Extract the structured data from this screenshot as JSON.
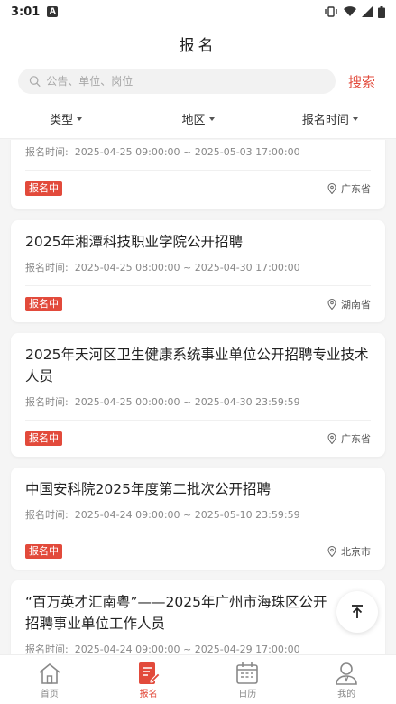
{
  "status_bar": {
    "time": "3:01",
    "notification_badge": "A"
  },
  "header": {
    "title": "报名"
  },
  "search": {
    "placeholder": "公告、单位、岗位",
    "button_label": "搜索"
  },
  "filters": [
    {
      "label": "类型"
    },
    {
      "label": "地区"
    },
    {
      "label": "报名时间"
    }
  ],
  "colors": {
    "accent": "#e24a3b"
  },
  "cards": [
    {
      "title": "",
      "time_label": "报名时间:",
      "time_range": "2025-04-25 09:00:00 ~ 2025-05-03 17:00:00",
      "status": "报名中",
      "location": "广东省"
    },
    {
      "title": "2025年湘潭科技职业学院公开招聘",
      "time_label": "报名时间:",
      "time_range": "2025-04-25 08:00:00 ~ 2025-04-30 17:00:00",
      "status": "报名中",
      "location": "湖南省"
    },
    {
      "title": "2025年天河区卫生健康系统事业单位公开招聘专业技术人员",
      "time_label": "报名时间:",
      "time_range": "2025-04-25 00:00:00 ~ 2025-04-30 23:59:59",
      "status": "报名中",
      "location": "广东省"
    },
    {
      "title": "中国安科院2025年度第二批次公开招聘",
      "time_label": "报名时间:",
      "time_range": "2025-04-24 09:00:00 ~ 2025-05-10 23:59:59",
      "status": "报名中",
      "location": "北京市"
    },
    {
      "title": "“百万英才汇南粤”——2025年广州市海珠区公开招聘事业单位工作人员",
      "time_label": "报名时间:",
      "time_range": "2025-04-24 09:00:00 ~ 2025-04-29 17:00:00",
      "status": "",
      "location": ""
    }
  ],
  "tabs": [
    {
      "label": "首页",
      "icon": "home-icon"
    },
    {
      "label": "报名",
      "icon": "signup-icon"
    },
    {
      "label": "日历",
      "icon": "calendar-icon"
    },
    {
      "label": "我的",
      "icon": "profile-icon"
    }
  ]
}
